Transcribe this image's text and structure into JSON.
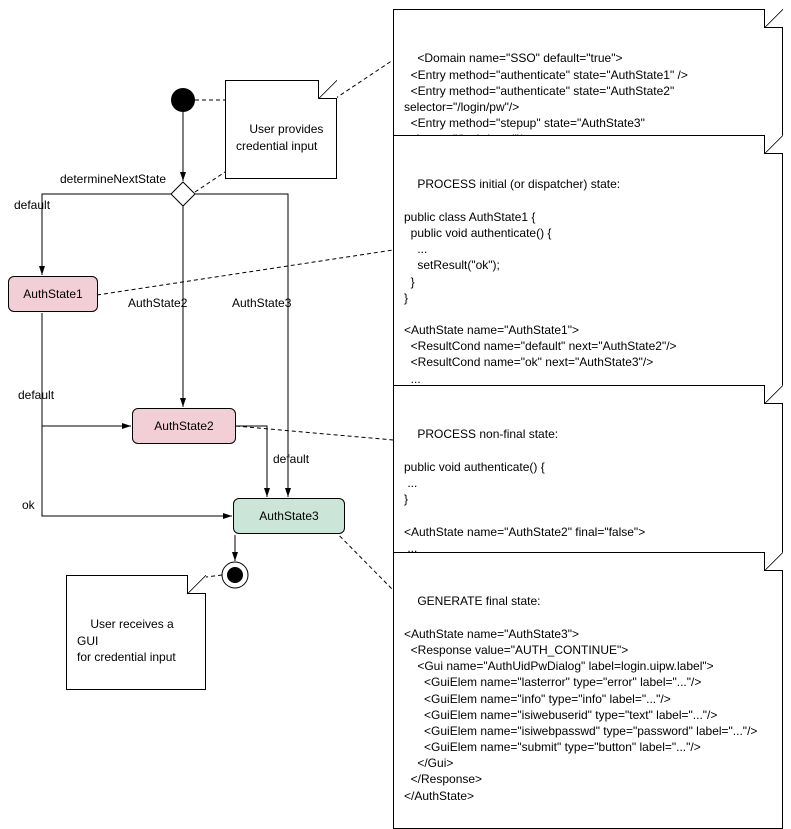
{
  "states": {
    "s1": "AuthState1",
    "s2": "AuthState2",
    "s3": "AuthState3"
  },
  "edges": {
    "determine": "determineNextState",
    "default1": "default",
    "branch2": "AuthState2",
    "branch3": "AuthState3",
    "default2": "default",
    "default3": "default",
    "ok": "ok"
  },
  "notes": {
    "input": "User provides\ncredential input",
    "gui": "User receives a GUI\nfor credential input",
    "domain": "<Domain name=\"SSO\" default=\"true\">\n  <Entry method=\"authenticate\" state=\"AuthState1\" />\n  <Entry method=\"authenticate\" state=\"AuthState2\" selector=\"/login/pw\"/>\n  <Entry method=\"stepup\" state=\"AuthState3\" selector=\"/login/saml\"/>\n</Domain>",
    "state1": "PROCESS initial (or dispatcher) state:\n\npublic class AuthState1 {\n  public void authenticate() {\n    ...\n    setResult(\"ok\");\n  }\n}\n\n<AuthState name=\"AuthState1\">\n  <ResultCond name=\"default\" next=\"AuthState2\"/>\n  <ResultCond name=\"ok\" next=\"AuthState3\"/>\n  ...\n</AuthState>",
    "state2": "PROCESS non-final state:\n\npublic void authenticate() {\n ...\n}\n\n<AuthState name=\"AuthState2\" final=\"false\">\n ...\n</AuthState>",
    "state3": "GENERATE final state:\n\n<AuthState name=\"AuthState3\">\n  <Response value=\"AUTH_CONTINUE\">\n    <Gui name=\"AuthUidPwDialog\" label=login.uipw.label\">\n      <GuiElem name=\"lasterror\" type=\"error\" label=\"...\"/>\n      <GuiElem name=\"info\" type=\"info\" label=\"...\"/>\n      <GuiElem name=\"isiwebuserid\" type=\"text\" label=\"...\"/>\n      <GuiElem name=\"isiwebpasswd\" type=\"password\" label=\"...\"/>\n      <GuiElem name=\"submit\" type=\"button\" label=\"...\"/>\n    </Gui>\n  </Response>\n</AuthState>"
  }
}
